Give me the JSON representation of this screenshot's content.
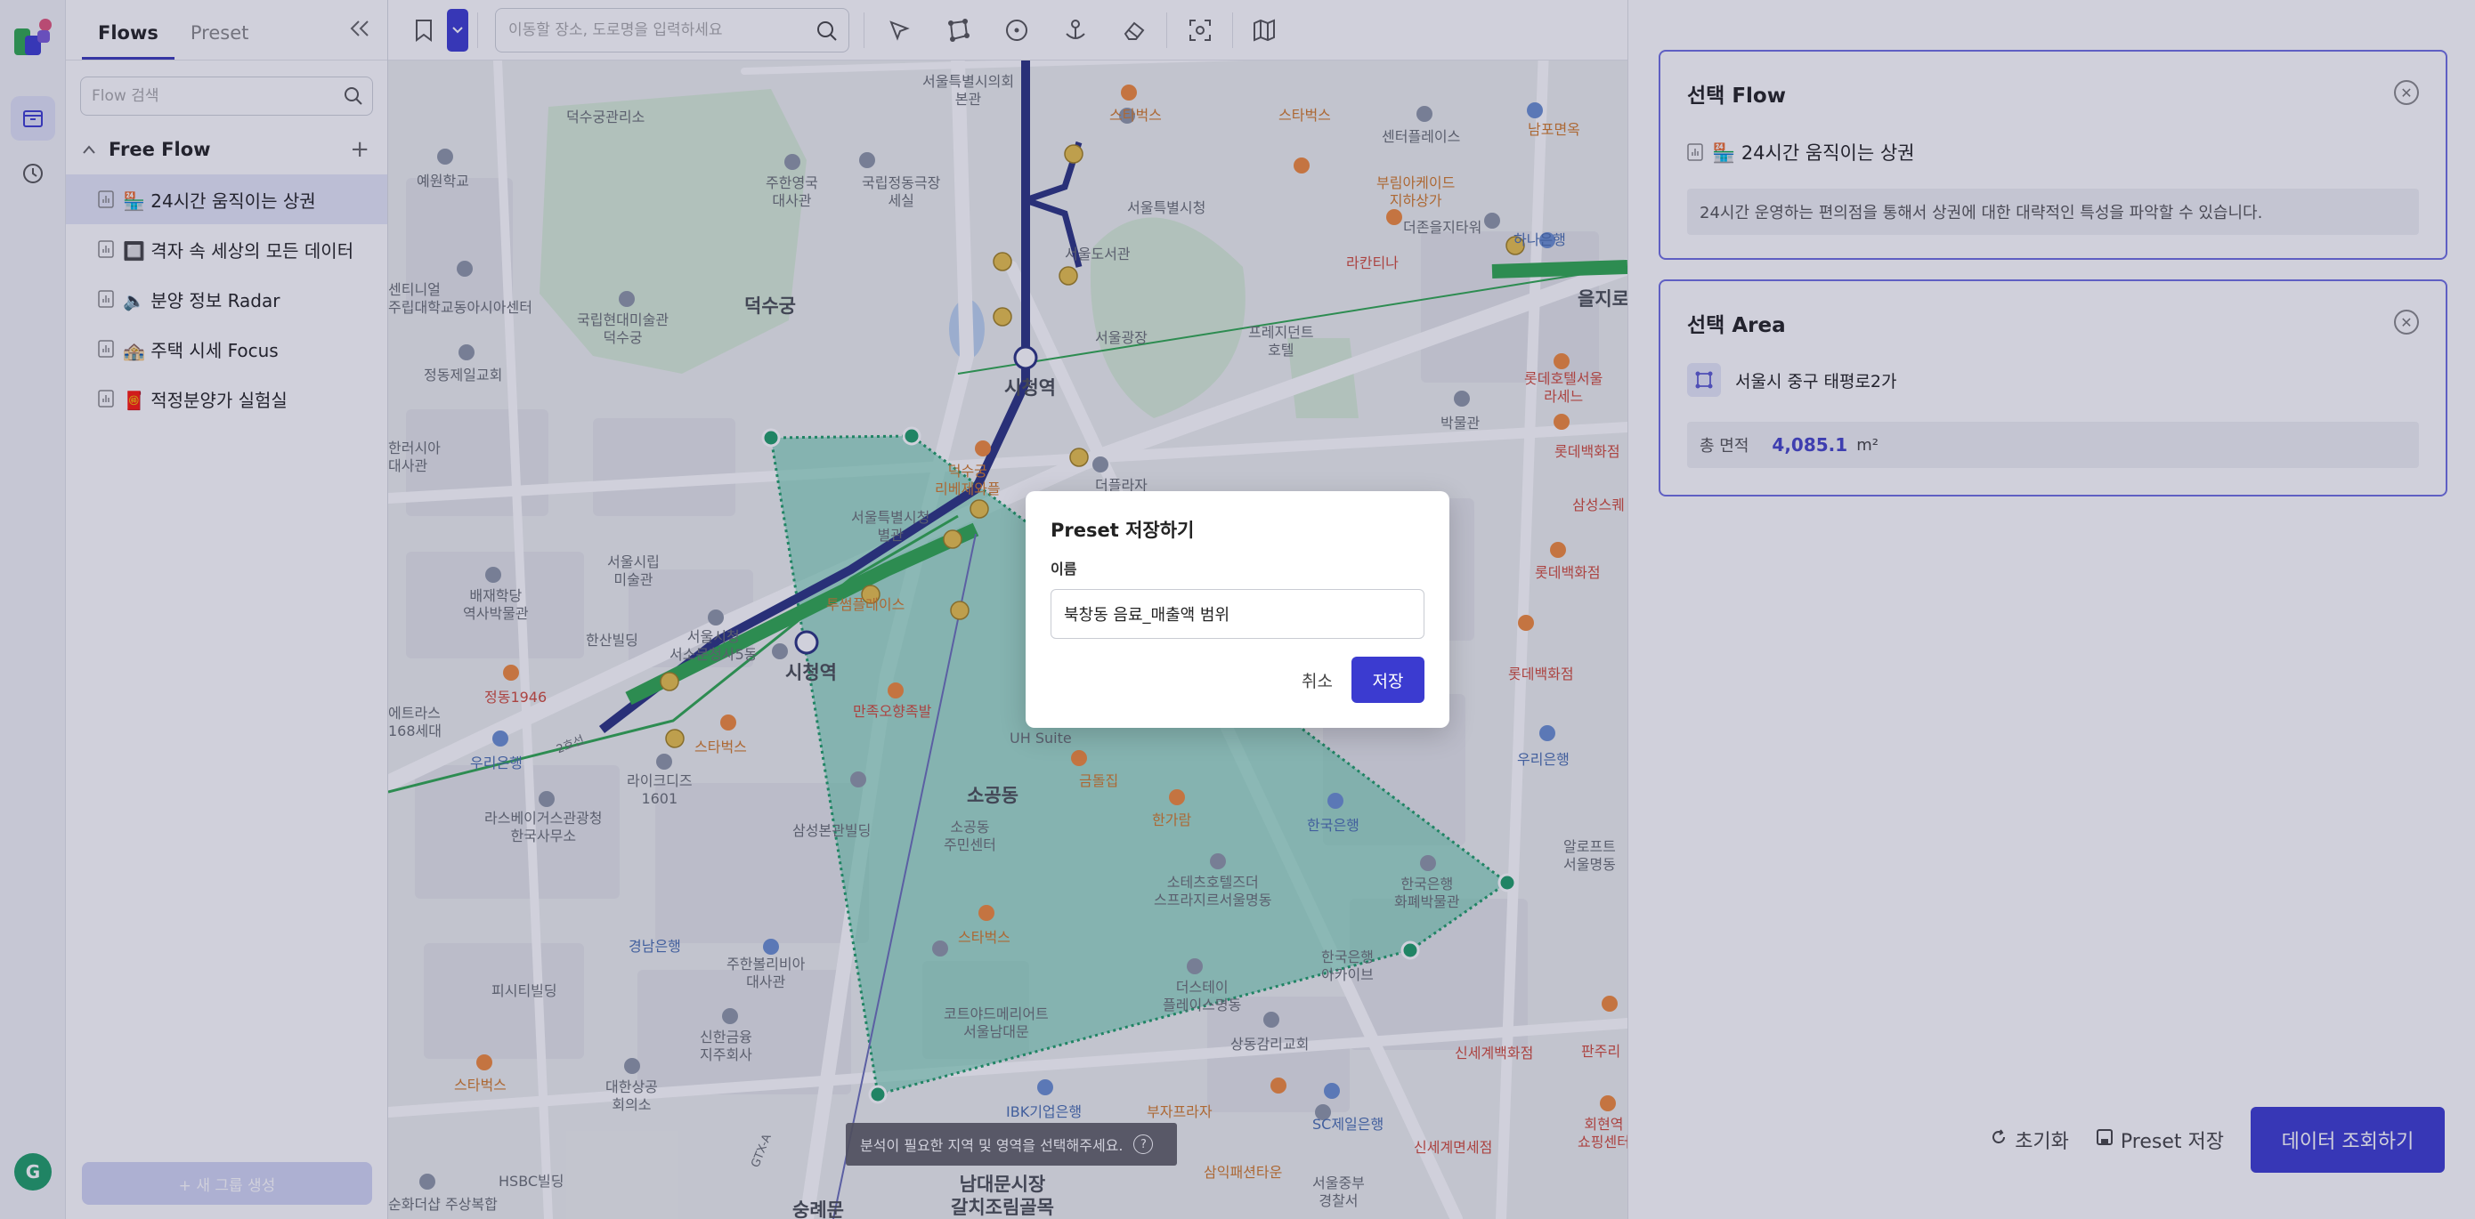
{
  "colors": {
    "accent": "#3b3bd0",
    "card_border": "#6f6fe0",
    "area_fill": "#5fc9a8",
    "route_green": "#2fa84f",
    "subway_blue": "#2a3380"
  },
  "rail": {
    "avatar_letter": "G",
    "icons": [
      "logo-icon",
      "archive-icon",
      "history-icon"
    ]
  },
  "sidebar": {
    "tabs": [
      "Flows",
      "Preset"
    ],
    "search_placeholder": "Flow 검색",
    "group_title": "Free Flow",
    "items": [
      {
        "label": "🏪 24시간 움직이는 상권"
      },
      {
        "label": "🔲 격자 속 세상의 모든 데이터"
      },
      {
        "label": "🔈 분양 정보 Radar"
      },
      {
        "label": "🏤 주택 시세 Focus"
      },
      {
        "label": "🧧 적정분양가 실험실"
      }
    ],
    "new_group_label": "+ 새 그룹 생성"
  },
  "toolbar": {
    "search_placeholder": "이동할 장소, 도로명을 입력하세요"
  },
  "map": {
    "hint": "분석이 필요한 지역 및 영역을 선택해주세요.",
    "labels": [
      {
        "t": "덕수궁",
        "c": "big"
      },
      {
        "t": "시청역",
        "c": "big"
      },
      {
        "t": "시청역",
        "c": "big"
      },
      {
        "t": "소공동",
        "c": "big"
      },
      {
        "t": "남대문시장\n갈치조림골목",
        "c": "big"
      },
      {
        "t": "덕수궁관리소",
        "c": ""
      },
      {
        "t": "예원학교",
        "c": ""
      },
      {
        "t": "주한영국\n대사관",
        "c": ""
      },
      {
        "t": "국립정동극장\n세실",
        "c": ""
      },
      {
        "t": "서울특별시의회\n본관",
        "c": ""
      },
      {
        "t": "스타벅스",
        "c": "orange"
      },
      {
        "t": "스타벅스",
        "c": "orange"
      },
      {
        "t": "센터플레이스",
        "c": ""
      },
      {
        "t": "남포면옥",
        "c": "orange"
      },
      {
        "t": "서울특별시청",
        "c": ""
      },
      {
        "t": "서울도서관",
        "c": ""
      },
      {
        "t": "부림아케이드\n지하상가",
        "c": "orange"
      },
      {
        "t": "더존을지타워",
        "c": ""
      },
      {
        "t": "하나은행",
        "c": "blue"
      },
      {
        "t": "을지로",
        "c": "big"
      },
      {
        "t": "라칸티나",
        "c": "red"
      },
      {
        "t": "센티니얼\n주립대학교동아시아센터",
        "c": ""
      },
      {
        "t": "국립현대미술관\n덕수궁",
        "c": ""
      },
      {
        "t": "서울광장",
        "c": ""
      },
      {
        "t": "프레지던트\n호텔",
        "c": ""
      },
      {
        "t": "정동제일교회",
        "c": ""
      },
      {
        "t": "롯데호텔서울\n라세느",
        "c": "red"
      },
      {
        "t": "박물관",
        "c": ""
      },
      {
        "t": "한러시아\n대사관",
        "c": ""
      },
      {
        "t": "덕수궁\n리베제와플",
        "c": "orange"
      },
      {
        "t": "더플라자",
        "c": ""
      },
      {
        "t": "롯데백화점",
        "c": "red"
      },
      {
        "t": "서울특별시청\n별관",
        "c": ""
      },
      {
        "t": "삼성스퀘",
        "c": "red"
      },
      {
        "t": "서울시립\n미술관",
        "c": ""
      },
      {
        "t": "롯데백화점",
        "c": "red"
      },
      {
        "t": "배재학당\n역사박물관",
        "c": ""
      },
      {
        "t": "투썸플레이스",
        "c": "orange"
      },
      {
        "t": "서울시청\n서소문청사5동",
        "c": ""
      },
      {
        "t": "한산빌딩",
        "c": ""
      },
      {
        "t": "정동1946",
        "c": "red"
      },
      {
        "t": "롯데백화점",
        "c": "red"
      },
      {
        "t": "만족오향족발",
        "c": "red"
      },
      {
        "t": "UH Suite",
        "c": ""
      },
      {
        "t": "스타벅스",
        "c": "orange"
      },
      {
        "t": "에트라스\n168세대",
        "c": ""
      },
      {
        "t": "우리은행",
        "c": "blue"
      },
      {
        "t": "우리은행",
        "c": "blue"
      },
      {
        "t": "라이크디즈\n1601",
        "c": ""
      },
      {
        "t": "금돌집",
        "c": "orange"
      },
      {
        "t": "한가람",
        "c": "orange"
      },
      {
        "t": "한국은행",
        "c": "blue"
      },
      {
        "t": "라스베이거스관광청\n한국사무소",
        "c": ""
      },
      {
        "t": "삼성본관빌딩",
        "c": ""
      },
      {
        "t": "소공동\n주민센터",
        "c": ""
      },
      {
        "t": "소테츠호텔즈더\n스프라지르서울명동",
        "c": ""
      },
      {
        "t": "한국은행\n화폐박물관",
        "c": ""
      },
      {
        "t": "알로프트\n서울명동",
        "c": ""
      },
      {
        "t": "경남은행",
        "c": "blue"
      },
      {
        "t": "주한볼리비아\n대사관",
        "c": ""
      },
      {
        "t": "스타벅스",
        "c": "orange"
      },
      {
        "t": "한국은행\n아카이브",
        "c": ""
      },
      {
        "t": "피시티빌딩",
        "c": ""
      },
      {
        "t": "더스테이\n플레이스명동",
        "c": ""
      },
      {
        "t": "코트야드메리어트\n서울남대문",
        "c": ""
      },
      {
        "t": "신한금융\n지주회사",
        "c": ""
      },
      {
        "t": "상동감리교회",
        "c": ""
      },
      {
        "t": "신세계백화점",
        "c": "red"
      },
      {
        "t": "스타벅스",
        "c": "orange"
      },
      {
        "t": "대한상공\n회의소",
        "c": ""
      },
      {
        "t": "IBK기업은행",
        "c": "blue"
      },
      {
        "t": "부자프라자",
        "c": "orange"
      },
      {
        "t": "SC제일은행",
        "c": "blue"
      },
      {
        "t": "신세계면세점",
        "c": "red"
      },
      {
        "t": "HSBC빌딩",
        "c": ""
      },
      {
        "t": "삼익패션타운",
        "c": "orange"
      },
      {
        "t": "서울중부\n경찰서",
        "c": ""
      },
      {
        "t": "순화더샵\n주상복합",
        "c": ""
      },
      {
        "t": "숭례문",
        "c": "big"
      },
      {
        "t": "판주리",
        "c": "red"
      },
      {
        "t": "회현역\n쇼핑센터",
        "c": "red"
      },
      {
        "t": "2호선",
        "c": ""
      },
      {
        "t": "GTX-A",
        "c": ""
      }
    ]
  },
  "right_panel": {
    "flow_card": {
      "title": "선택 Flow",
      "flow_name": "🏪 24시간 움직이는 상권",
      "description": "24시간 운영하는 편의점을 통해서 상권에 대한 대략적인 특성을 파악할 수 있습니다."
    },
    "area_card": {
      "title": "선택 Area",
      "area_name": "서울시 중구 태평로2가",
      "stat_label": "총 면적",
      "stat_value": "4,085.1",
      "stat_unit": "m²"
    },
    "reset_label": "초기화",
    "preset_save_label": "Preset 저장",
    "query_label": "데이터 조회하기"
  },
  "modal": {
    "title": "Preset 저장하기",
    "field_label": "이름",
    "field_value": "북창동 음료_매출액 범위",
    "cancel_label": "취소",
    "save_label": "저장"
  }
}
